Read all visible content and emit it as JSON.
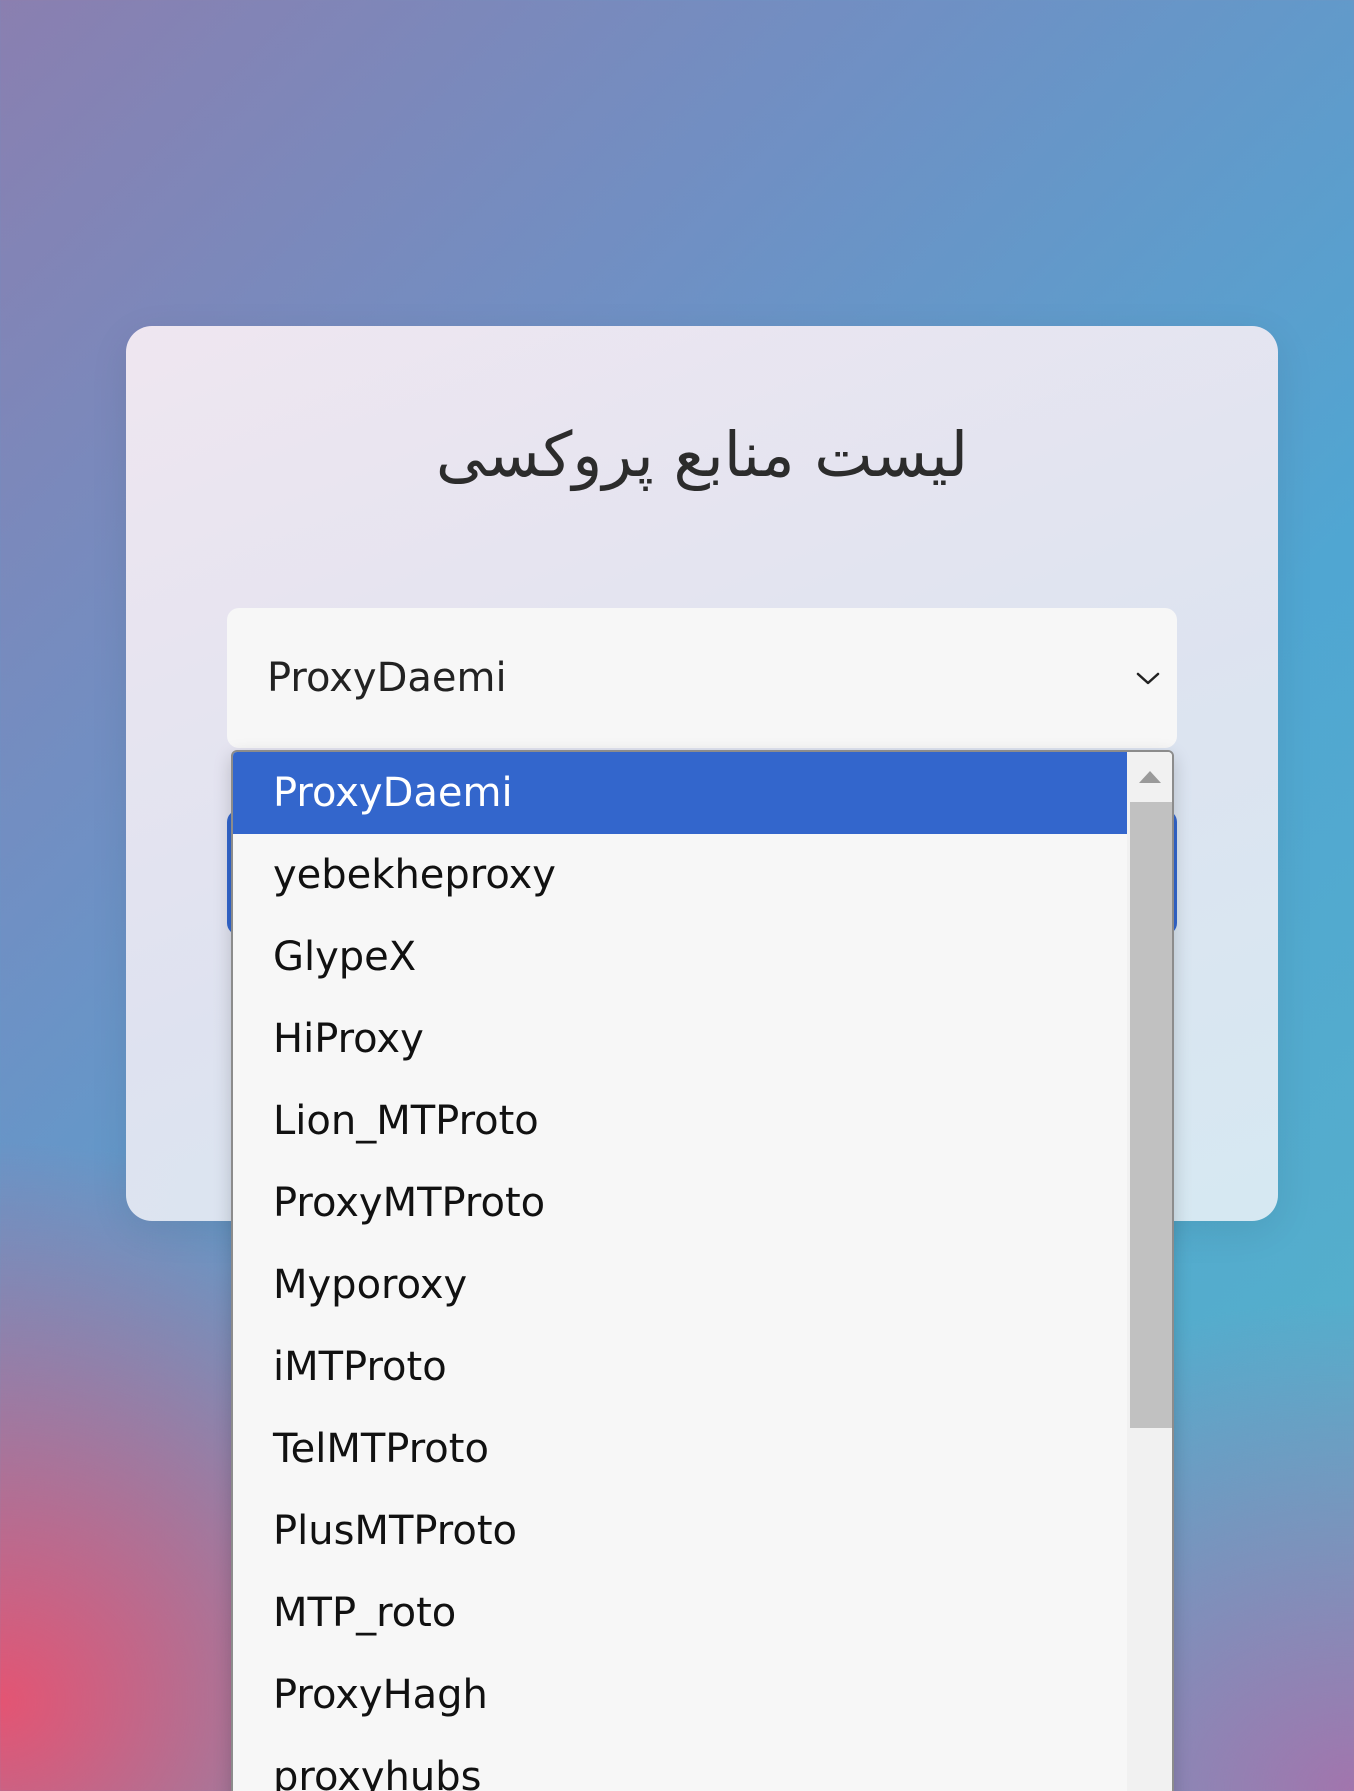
{
  "card": {
    "title": "لیست منابع پروکسی"
  },
  "select": {
    "value": "ProxyDaemi"
  },
  "dropdown": {
    "options": [
      "ProxyDaemi",
      "yebekheproxy",
      "GlypeX",
      "HiProxy",
      "Lion_MTProto",
      "ProxyMTProto",
      "Myporoxy",
      "iMTProto",
      "TelMTProto",
      "PlusMTProto",
      "MTP_roto",
      "ProxyHagh",
      "proxyhubs"
    ],
    "selected_index": 0
  },
  "icons": {
    "chevron": "chevron-down-icon",
    "scroll_up": "scroll-up-arrow-icon"
  },
  "colors": {
    "selected_option_bg": "#3366cc",
    "button_bg": "#3367cf"
  }
}
